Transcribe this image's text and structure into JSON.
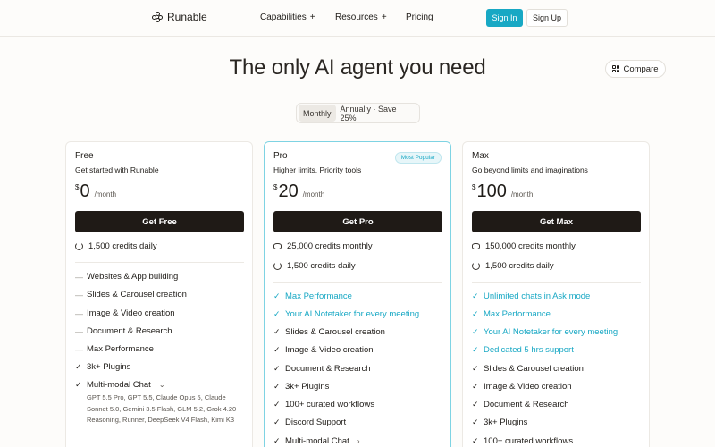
{
  "nav": {
    "logo": "Runable",
    "links": [
      "Capabilities",
      "Resources",
      "Pricing"
    ],
    "plus": "+",
    "sign_in": "Sign In",
    "sign_up": "Sign Up"
  },
  "hero": {
    "title": "The only AI agent you need",
    "compare": "Compare"
  },
  "billing": {
    "monthly": "Monthly",
    "annually": "Annually · Save 25%"
  },
  "colors": {
    "accent": "#18a8c4",
    "cta": "#1f1a16"
  },
  "plans": [
    {
      "name": "Free",
      "subtitle": "Get started with Runable",
      "currency": "$",
      "price": "0",
      "period": "/month",
      "cta": "Get Free",
      "credits": [
        "1,500 credits daily"
      ],
      "features": [
        {
          "mark": "—",
          "text": "Websites & App building"
        },
        {
          "mark": "—",
          "text": "Slides & Carousel creation"
        },
        {
          "mark": "—",
          "text": "Image & Video creation"
        },
        {
          "mark": "—",
          "text": "Document & Research"
        },
        {
          "mark": "—",
          "text": "Max Performance"
        },
        {
          "mark": "✓",
          "text": "3k+ Plugins"
        },
        {
          "mark": "✓",
          "text": "Multi-modal Chat"
        }
      ],
      "models": "GPT 5.5 Pro, GPT 5.5, Claude Opus 5, Claude Sonnet 5.0, Gemini 3.5 Flash, GLM 5.2, Grok 4.20 Reasoning, Runner, DeepSeek V4 Flash, Kimi K3"
    },
    {
      "name": "Pro",
      "badge": "Most Popular",
      "subtitle": "Higher limits, Priority tools",
      "currency": "$",
      "price": "20",
      "period": "/month",
      "cta": "Get Pro",
      "credits": [
        "25,000 credits monthly",
        "1,500 credits daily"
      ],
      "features": [
        {
          "mark": "✓",
          "text": "Max Performance"
        },
        {
          "mark": "✓",
          "text": "Your AI Notetaker for every meeting"
        },
        {
          "mark": "✓",
          "text": "Slides & Carousel creation"
        },
        {
          "mark": "✓",
          "text": "Image & Video creation"
        },
        {
          "mark": "✓",
          "text": "Document & Research"
        },
        {
          "mark": "✓",
          "text": "3k+ Plugins"
        },
        {
          "mark": "✓",
          "text": "100+ curated workflows"
        },
        {
          "mark": "✓",
          "text": "Discord Support"
        },
        {
          "mark": "✓",
          "text": "Multi-modal Chat"
        }
      ]
    },
    {
      "name": "Max",
      "subtitle": "Go beyond limits and imaginations",
      "currency": "$",
      "price": "100",
      "period": "/month",
      "cta": "Get Max",
      "credits": [
        "150,000 credits monthly",
        "1,500 credits daily"
      ],
      "features": [
        {
          "mark": "✓",
          "text": "Unlimited chats in Ask mode"
        },
        {
          "mark": "✓",
          "text": "Max Performance"
        },
        {
          "mark": "✓",
          "text": "Your AI Notetaker for every meeting"
        },
        {
          "mark": "✓",
          "text": "Dedicated 5 hrs support"
        },
        {
          "mark": "✓",
          "text": "Slides & Carousel creation"
        },
        {
          "mark": "✓",
          "text": "Image & Video creation"
        },
        {
          "mark": "✓",
          "text": "Document & Research"
        },
        {
          "mark": "✓",
          "text": "3k+ Plugins"
        },
        {
          "mark": "✓",
          "text": "100+ curated workflows"
        }
      ]
    }
  ]
}
